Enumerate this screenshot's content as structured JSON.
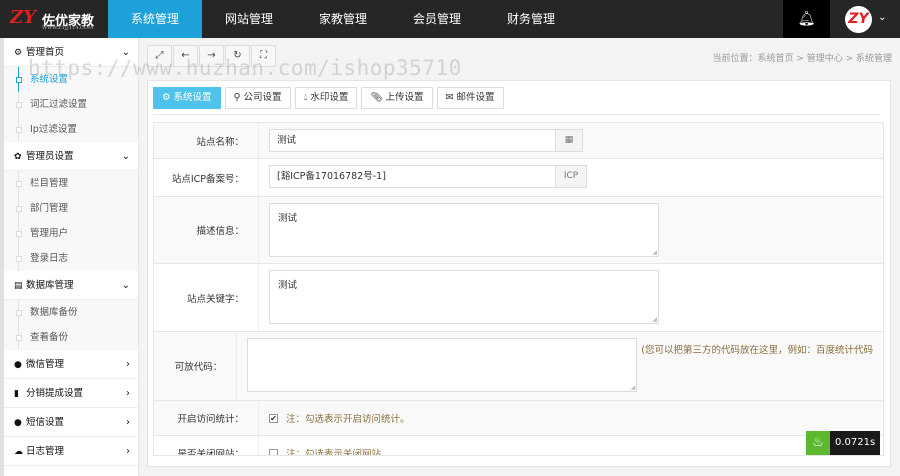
{
  "header": {
    "logo_text": "佐优家教",
    "logo_sub": "WWW.ZYJJ114.COM",
    "nav": [
      "系统管理",
      "网站管理",
      "家教管理",
      "会员管理",
      "财务管理"
    ],
    "active_nav": 0
  },
  "sidebar": {
    "groups": [
      {
        "label": "管理首页",
        "icon": "⚙",
        "chev": "⌄",
        "items": [
          "系统设置",
          "词汇过滤设置",
          "Ip过滤设置"
        ]
      },
      {
        "label": "管理员设置",
        "icon": "✿",
        "chev": "⌄",
        "items": [
          "栏目管理",
          "部门管理",
          "管理用户",
          "登录日志"
        ]
      },
      {
        "label": "数据库管理",
        "icon": "▤",
        "chev": "⌄",
        "items": [
          "数据库备份",
          "查看备份"
        ]
      },
      {
        "label": "微信管理",
        "icon": "●",
        "chev": "›",
        "items": []
      },
      {
        "label": "分销提成设置",
        "icon": "▮",
        "chev": "›",
        "items": []
      },
      {
        "label": "短信设置",
        "icon": "●",
        "chev": "›",
        "items": []
      },
      {
        "label": "日志管理",
        "icon": "☁",
        "chev": "›",
        "items": []
      }
    ]
  },
  "breadcrumb": "当前位置：系统首页 > 管理中心 > 系统管理",
  "watermark": "https://www.huzhan.com/ishop35710",
  "tabs": [
    "系统设置",
    "公司设置",
    "水印设置",
    "上传设置",
    "邮件设置"
  ],
  "form": {
    "site_name_label": "站点名称：",
    "site_name": "测试",
    "icp_label": "站点ICP备案号：",
    "icp": "[豁ICP备17016782号-1]",
    "icp_addon": "ICP",
    "desc_label": "描述信息：",
    "desc": "测试",
    "keywords_label": "站点关键字：",
    "keywords": "测试",
    "code_label": "可放代码：",
    "code": "",
    "code_note": "(您可以把第三方的代码放在这里，例如：百度统计代码",
    "stats_label": "开启访问统计：",
    "stats_checked": true,
    "stats_note": "注：勾选表示开启访问统计。",
    "close_label": "是否关闭网站：",
    "close_checked": false,
    "close_note": "注：勾选表示关闭网站"
  },
  "timer": "0.0721s"
}
